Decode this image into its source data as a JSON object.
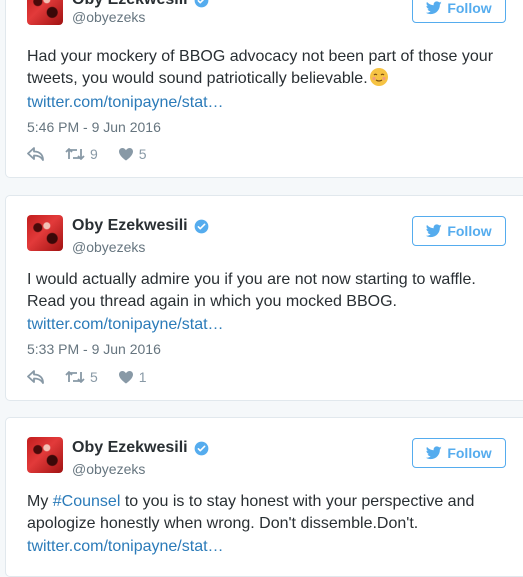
{
  "tweets": [
    {
      "name": "Oby Ezekwesili",
      "handle": "@obyezeks",
      "follow_label": "Follow",
      "text": "Had your mockery of BBOG advocacy not been part of those your tweets, you would sound patriotically believable.",
      "link": "twitter.com/tonipayne/stat…",
      "time": "5:46 PM - 9 Jun 2016",
      "retweets": "9",
      "likes": "5"
    },
    {
      "name": "Oby Ezekwesili",
      "handle": "@obyezeks",
      "follow_label": "Follow",
      "text": "I would actually admire you if you are not now starting to waffle. Read you thread again in which you mocked BBOG.",
      "link": "twitter.com/tonipayne/stat…",
      "time": "5:33 PM - 9 Jun 2016",
      "retweets": "5",
      "likes": "1"
    },
    {
      "name": "Oby Ezekwesili",
      "handle": "@obyezeks",
      "follow_label": "Follow",
      "text_before": "My ",
      "hashtag": "#Counsel",
      "text_after": " to you is to stay honest with your perspective and apologize honestly when wrong. Don't dissemble.Don't.",
      "link": "twitter.com/tonipayne/stat…"
    }
  ],
  "colors": {
    "accent": "#55acee",
    "link": "#2b7bb9",
    "muted": "#66757f"
  }
}
